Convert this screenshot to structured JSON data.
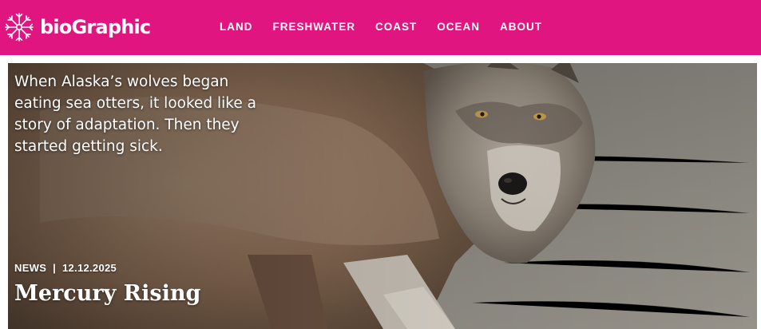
{
  "header": {
    "logo_text": "bioGraphic",
    "logo_icon": "starburst-logo-icon",
    "background_color": "#e0157f",
    "nav": [
      {
        "label": "LAND"
      },
      {
        "label": "FRESHWATER"
      },
      {
        "label": "COAST"
      },
      {
        "label": "OCEAN"
      },
      {
        "label": "ABOUT"
      }
    ]
  },
  "hero": {
    "dek": "When Alaska’s wolves began eating sea otters, it looked like a story of adaptation. Then they started getting sick.",
    "category": "NEWS",
    "separator": "|",
    "date": "12.12.2025",
    "title": "Mercury Rising"
  }
}
